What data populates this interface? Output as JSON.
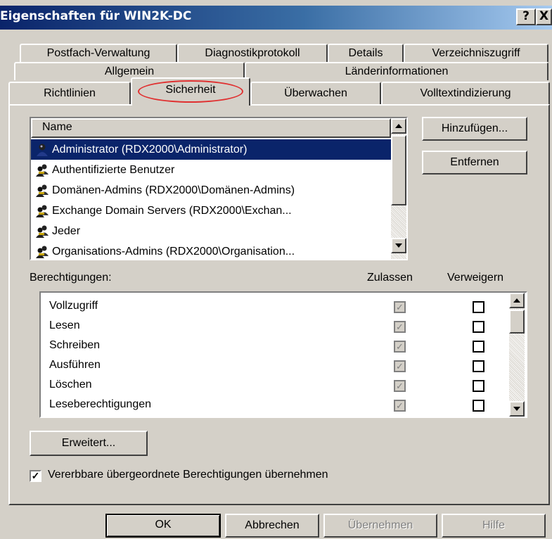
{
  "window": {
    "title": "Eigenschaften für WIN2K-DC",
    "help_button": "?",
    "close_button": "X"
  },
  "tabs": {
    "row1": [
      "Postfach-Verwaltung",
      "Diagnostikprotokoll",
      "Details",
      "Verzeichniszugriff"
    ],
    "row2": [
      "Allgemein",
      "Länderinformationen"
    ],
    "row3": [
      "Richtlinien",
      "Sicherheit",
      "Überwachen",
      "Volltextindizierung"
    ],
    "active": "Sicherheit",
    "highlight_color": "#e03030"
  },
  "users": {
    "column_header": "Name",
    "items": [
      {
        "name": "Administrator (RDX2000\\Administrator)",
        "icon": "user-icon",
        "selected": true
      },
      {
        "name": "Authentifizierte Benutzer",
        "icon": "group-icon",
        "selected": false
      },
      {
        "name": "Domänen-Admins (RDX2000\\Domänen-Admins)",
        "icon": "group-icon",
        "selected": false
      },
      {
        "name": "Exchange Domain Servers (RDX2000\\Exchan...",
        "icon": "group-icon",
        "selected": false
      },
      {
        "name": "Jeder",
        "icon": "group-icon",
        "selected": false
      },
      {
        "name": "Organisations-Admins (RDX2000\\Organisation...",
        "icon": "group-icon",
        "selected": false
      }
    ],
    "add_button": "Hinzufügen...",
    "remove_button": "Entfernen"
  },
  "permissions": {
    "label": "Berechtigungen:",
    "allow_header": "Zulassen",
    "deny_header": "Verweigern",
    "items": [
      {
        "name": "Vollzugriff",
        "allow": true,
        "deny": false
      },
      {
        "name": "Lesen",
        "allow": true,
        "deny": false
      },
      {
        "name": "Schreiben",
        "allow": true,
        "deny": false
      },
      {
        "name": "Ausführen",
        "allow": true,
        "deny": false
      },
      {
        "name": "Löschen",
        "allow": true,
        "deny": false
      },
      {
        "name": "Leseberechtigungen",
        "allow": true,
        "deny": false
      }
    ]
  },
  "advanced_button": "Erweitert...",
  "inherit": {
    "label": "Vererbbare übergeordnete Berechtigungen übernehmen",
    "checked": true
  },
  "footer": {
    "ok": "OK",
    "cancel": "Abbrechen",
    "apply": "Übernehmen",
    "help": "Hilfe"
  },
  "colors": {
    "selection": "#0a246a",
    "face": "#d4d0c8"
  }
}
